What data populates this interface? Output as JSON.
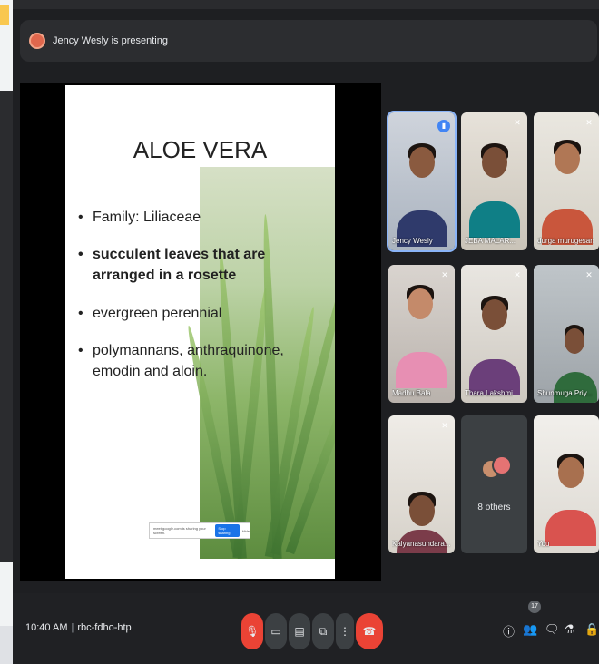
{
  "banner": {
    "title": "Jency Wesly is presenting"
  },
  "slide": {
    "heading": "ALOE VERA",
    "bullets": [
      {
        "text": "Family: Liliaceae",
        "bold": false
      },
      {
        "text": "succulent leaves that are arranged in a rosette",
        "bold": true
      },
      {
        "text": "evergreen perennial",
        "bold": false
      },
      {
        "text": "polymannans, anthraquinone, emodin and aloin.",
        "bold": false
      }
    ],
    "share_bar": {
      "text": "meet.google.com is sharing your screen.",
      "stop_label": "Stop sharing",
      "hide_label": "Hide"
    }
  },
  "participants": [
    {
      "name": "Jency Wesly",
      "speaking": true
    },
    {
      "name": "JEBA MALAR...",
      "muted": true
    },
    {
      "name": "durga murugesan",
      "muted": true
    },
    {
      "name": "Madhu Bala",
      "muted": true
    },
    {
      "name": "Thara Lakshmi",
      "muted": true
    },
    {
      "name": "Shunmuga Priy...",
      "muted": true
    },
    {
      "name": "Kalyanasundara...",
      "muted": true
    },
    {
      "name": "8 others"
    },
    {
      "name": "You"
    }
  ],
  "meeting": {
    "time": "10:40 AM",
    "code": "rbc-fdho-htp",
    "participant_count": "17"
  },
  "colors": {
    "end_call": "#ea4335",
    "active_speaker": "#8ab4f8"
  }
}
